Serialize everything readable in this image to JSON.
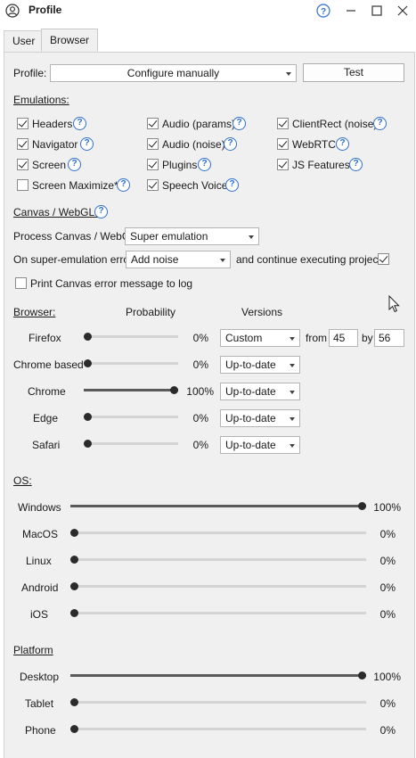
{
  "window": {
    "title": "Profile"
  },
  "tabs": [
    {
      "label": "User",
      "active": false
    },
    {
      "label": "Browser",
      "active": true
    }
  ],
  "profile": {
    "label": "Profile:",
    "value": "Configure manually",
    "test_label": "Test"
  },
  "emulations": {
    "title": "Emulations:",
    "items": [
      {
        "label": "Headers",
        "checked": true
      },
      {
        "label": "Audio (params)",
        "checked": true
      },
      {
        "label": "ClientRect (noise)",
        "checked": true
      },
      {
        "label": "Navigator",
        "checked": true
      },
      {
        "label": "Audio (noise)",
        "checked": true
      },
      {
        "label": "WebRTC",
        "checked": true
      },
      {
        "label": "Screen",
        "checked": true
      },
      {
        "label": "Plugins",
        "checked": true
      },
      {
        "label": "JS Features",
        "checked": true
      },
      {
        "label": "Screen Maximize*",
        "checked": false
      },
      {
        "label": "Speech Voice",
        "checked": true
      }
    ]
  },
  "canvas": {
    "title": "Canvas / WebGL:",
    "process_label": "Process Canvas / WebGL",
    "process_value": "Super emulation",
    "error_label": "On super-emulation error",
    "error_value": "Add noise",
    "continue_label": "and continue executing project",
    "continue_checked": true,
    "print_label": "Print Canvas error message to log",
    "print_checked": false
  },
  "browser": {
    "title": "Browser:",
    "probability_header": "Probability",
    "versions_header": "Versions",
    "from_label": "from",
    "by_label": "by",
    "from_value": "45",
    "by_value": "56",
    "rows": [
      {
        "name": "Firefox",
        "percent": "0%",
        "version": "Custom",
        "fraction": 0
      },
      {
        "name": "Chrome based",
        "percent": "0%",
        "version": "Up-to-date",
        "fraction": 0
      },
      {
        "name": "Chrome",
        "percent": "100%",
        "version": "Up-to-date",
        "fraction": 1
      },
      {
        "name": "Edge",
        "percent": "0%",
        "version": "Up-to-date",
        "fraction": 0
      },
      {
        "name": "Safari",
        "percent": "0%",
        "version": "Up-to-date",
        "fraction": 0
      }
    ]
  },
  "os": {
    "title": "OS:",
    "rows": [
      {
        "name": "Windows",
        "percent": "100%",
        "fraction": 1
      },
      {
        "name": "MacOS",
        "percent": "0%",
        "fraction": 0
      },
      {
        "name": "Linux",
        "percent": "0%",
        "fraction": 0
      },
      {
        "name": "Android",
        "percent": "0%",
        "fraction": 0
      },
      {
        "name": "iOS",
        "percent": "0%",
        "fraction": 0
      }
    ]
  },
  "platform": {
    "title": "Platform",
    "rows": [
      {
        "name": "Desktop",
        "percent": "100%",
        "fraction": 1
      },
      {
        "name": "Tablet",
        "percent": "0%",
        "fraction": 0
      },
      {
        "name": "Phone",
        "percent": "0%",
        "fraction": 0
      }
    ]
  },
  "icons": {
    "app": "user-circle-icon",
    "help": "help-icon",
    "minimize": "minimize-icon",
    "maximize": "maximize-icon",
    "close": "close-icon"
  }
}
